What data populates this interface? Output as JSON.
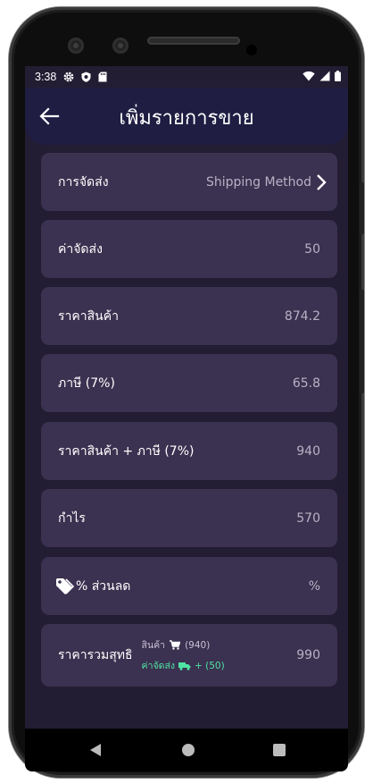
{
  "status_bar": {
    "time": "3:38",
    "icons_left": [
      "gear-icon",
      "shield-icon",
      "sd-card-icon"
    ],
    "icons_right": [
      "wifi-icon",
      "cell-signal-icon",
      "battery-icon"
    ]
  },
  "header": {
    "title": "เพิ่มรายการขาย",
    "back_icon": "arrow-left-icon"
  },
  "rows": [
    {
      "label": "การจัดส่ง",
      "value": "Shipping Method"
    },
    {
      "label": "ค่าจัดส่ง",
      "value": "50"
    },
    {
      "label": "ราคาสินค้า",
      "value": "874.2"
    },
    {
      "label": "ภาษี (7%)",
      "value": "65.8"
    },
    {
      "label": "ราคาสินค้า + ภาษี (7%)",
      "value": "940"
    },
    {
      "label": "กำไร",
      "value": "570"
    },
    {
      "label": "% ส่วนลด",
      "value": "%"
    }
  ],
  "total": {
    "label": "ราคารวมสุทธิ",
    "product_label": "สินค้า",
    "product_value": "(940)",
    "shipping_label": "ค่าจัดส่ง",
    "shipping_value": "+ (50)",
    "value": "990"
  },
  "colors": {
    "background": "#231d33",
    "card": "#3b3150",
    "appbar": "#1f1d42",
    "accent_green": "#4fe3a4"
  }
}
